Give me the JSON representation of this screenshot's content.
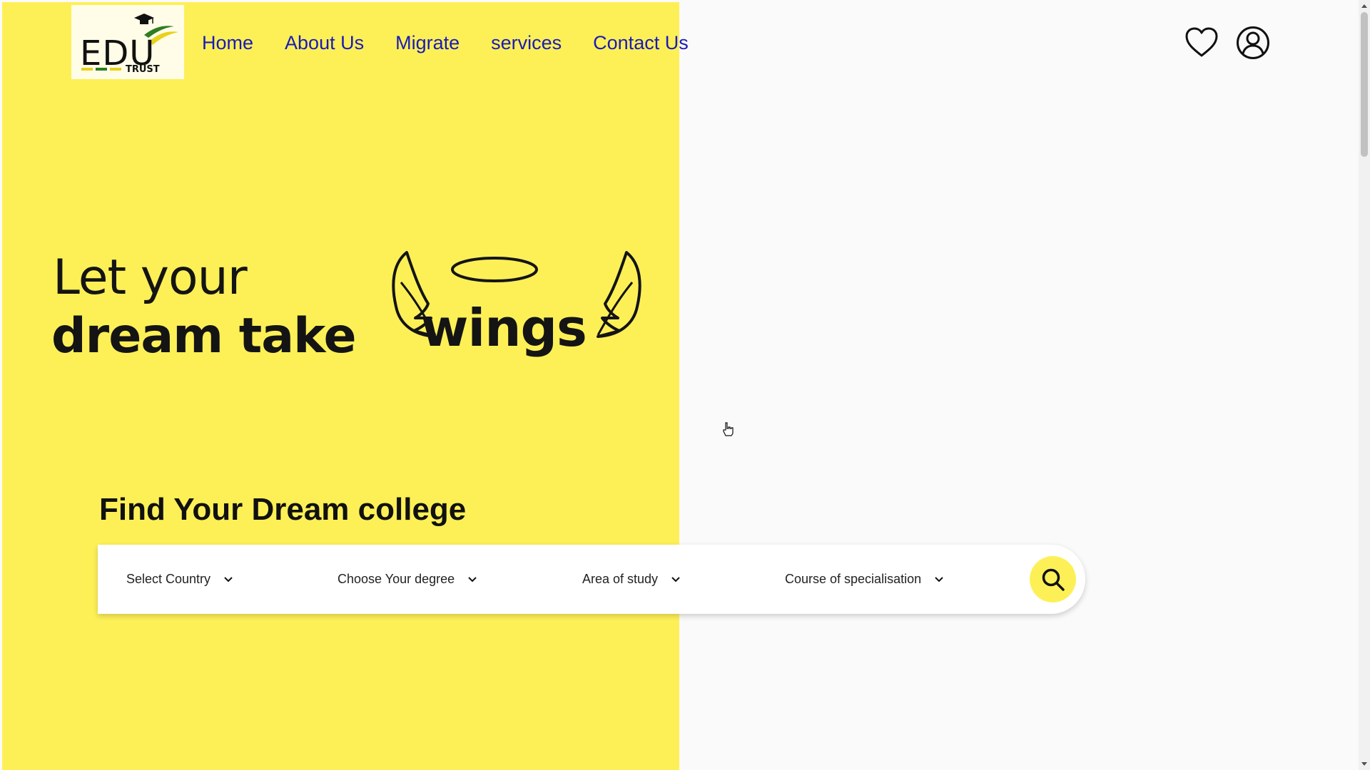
{
  "brand": {
    "logo_main": "EDU",
    "logo_sub": "TRUST",
    "colors": {
      "yellow": "#fdf057",
      "nav_link": "#1a1ab8",
      "logo_green": "#2e7d1f",
      "logo_yellow": "#e8d21a"
    }
  },
  "nav": {
    "items": [
      {
        "label": "Home"
      },
      {
        "label": "About Us"
      },
      {
        "label": "Migrate"
      },
      {
        "label": "services"
      },
      {
        "label": "Contact Us"
      }
    ]
  },
  "header_icons": {
    "wishlist": "heart-icon",
    "account": "user-icon"
  },
  "hero": {
    "line1": "Let your",
    "line2": "dream take",
    "word": "wings"
  },
  "search": {
    "title": "Find Your Dream college",
    "selects": [
      {
        "label": "Select Country"
      },
      {
        "label": "Choose Your degree"
      },
      {
        "label": "Area of study"
      },
      {
        "label": "Course of specialisation"
      }
    ],
    "button_icon": "search-icon"
  }
}
